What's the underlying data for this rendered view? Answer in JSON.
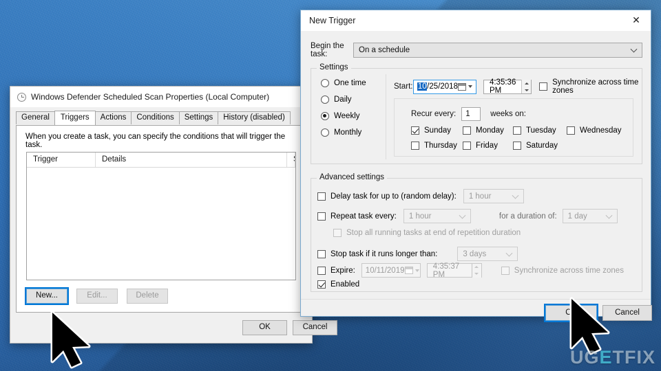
{
  "desktop": {
    "watermark_part1": "UG",
    "watermark_part2": "E",
    "watermark_part3": "TFIX"
  },
  "properties_window": {
    "title": "Windows Defender Scheduled Scan Properties (Local Computer)",
    "icon": "clock-icon",
    "tabs": [
      {
        "label": "General",
        "active": false
      },
      {
        "label": "Triggers",
        "active": true
      },
      {
        "label": "Actions",
        "active": false
      },
      {
        "label": "Conditions",
        "active": false
      },
      {
        "label": "Settings",
        "active": false
      },
      {
        "label": "History (disabled)",
        "active": false
      }
    ],
    "note": "When you create a task, you can specify the conditions that will trigger the task.",
    "list": {
      "columns": [
        "Trigger",
        "Details",
        "Status"
      ],
      "rows": []
    },
    "buttons": {
      "new": "New...",
      "edit": "Edit...",
      "delete": "Delete",
      "ok": "OK",
      "cancel": "Cancel"
    }
  },
  "new_trigger_dialog": {
    "title": "New Trigger",
    "close_icon": "close-icon",
    "begin_task_label": "Begin the task:",
    "begin_task_value": "On a schedule",
    "settings_group_label": "Settings",
    "schedule_options": [
      {
        "label": "One time",
        "mnemonic_index": 1,
        "selected": false
      },
      {
        "label": "Daily",
        "mnemonic_index": 0,
        "selected": false
      },
      {
        "label": "Weekly",
        "mnemonic_index": 0,
        "selected": true
      },
      {
        "label": "Monthly",
        "mnemonic_index": 0,
        "selected": false
      }
    ],
    "start_label": "Start:",
    "start_date_selected": "10",
    "start_date_rest": "/25/2018",
    "start_time": "4:35:36 PM",
    "sync_time_zones_label": "Synchronize across time zones",
    "sync_time_zones_checked": false,
    "recur_every_label": "Recur every:",
    "recur_every_value": "1",
    "weeks_on_label": "weeks on:",
    "weekdays": [
      {
        "label": "Sunday",
        "checked": true
      },
      {
        "label": "Monday",
        "checked": false
      },
      {
        "label": "Tuesday",
        "checked": false
      },
      {
        "label": "Wednesday",
        "checked": false
      },
      {
        "label": "Thursday",
        "checked": false
      },
      {
        "label": "Friday",
        "checked": false
      },
      {
        "label": "Saturday",
        "checked": false
      }
    ],
    "advanced_group_label": "Advanced settings",
    "delay_task_label": "Delay task for up to (random delay):",
    "delay_task_checked": false,
    "delay_task_value": "1 hour",
    "repeat_task_label": "Repeat task every:",
    "repeat_task_checked": false,
    "repeat_task_value": "1 hour",
    "duration_label": "for a duration of:",
    "duration_value": "1 day",
    "stop_repetition_label": "Stop all running tasks at end of repetition duration",
    "stop_repetition_checked": false,
    "stop_task_label": "Stop task if it runs longer than:",
    "stop_task_checked": false,
    "stop_task_value": "3 days",
    "expire_label": "Expire:",
    "expire_checked": false,
    "expire_date": "10/11/2019",
    "expire_time": "4:35:37 PM",
    "expire_sync_label": "Synchronize across time zones",
    "expire_sync_checked": false,
    "enabled_label": "Enabled",
    "enabled_checked": true,
    "ok_label": "OK",
    "cancel_label": "Cancel"
  }
}
